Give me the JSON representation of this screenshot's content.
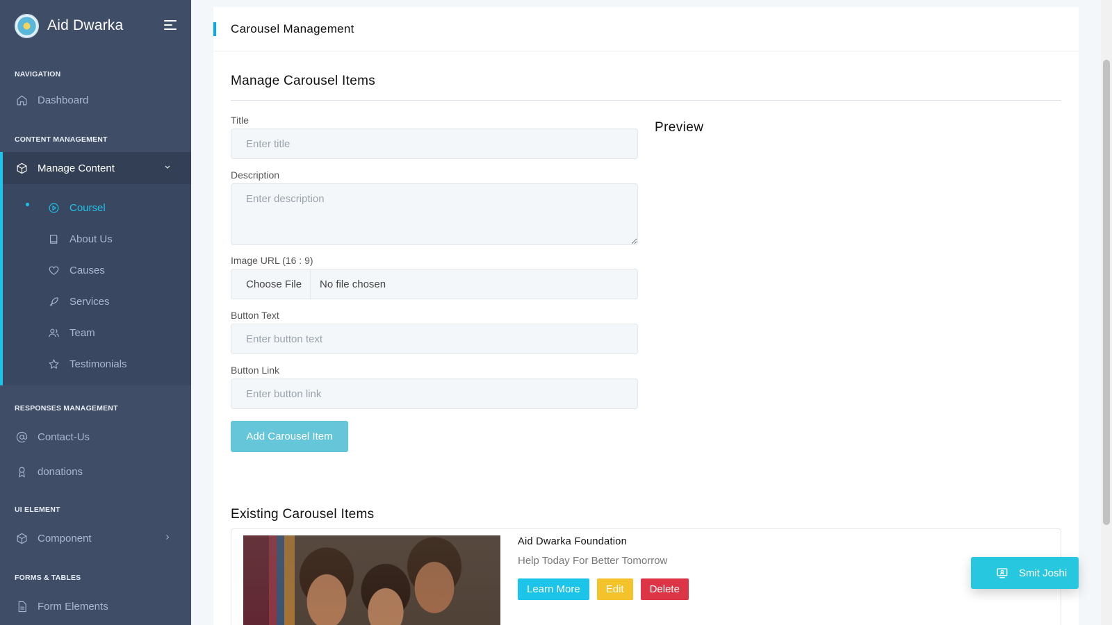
{
  "sidebar": {
    "brand": "Aid Dwarka",
    "sections": {
      "navigation": "NAVIGATION",
      "content_management": "CONTENT MANAGEMENT",
      "responses_management": "RESPONSES MANAGEMENT",
      "ui_element": "UI ELEMENT",
      "forms_tables": "FORMS & TABLES"
    },
    "dashboard": "Dashboard",
    "manage_content": "Manage Content",
    "sub_items": {
      "coursel": "Coursel",
      "about_us": "About Us",
      "causes": "Causes",
      "services": "Services",
      "team": "Team",
      "testimonials": "Testimonials"
    },
    "contact_us": "Contact-Us",
    "donations": "donations",
    "component": "Component",
    "form_elements": "Form Elements"
  },
  "page": {
    "header": "Carousel Management",
    "section_title": "Manage Carousel Items",
    "preview_title": "Preview",
    "existing_title": "Existing Carousel Items"
  },
  "form": {
    "title_label": "Title",
    "title_placeholder": "Enter title",
    "title_value": "",
    "description_label": "Description",
    "description_placeholder": "Enter description",
    "description_value": "",
    "image_label": "Image URL (16 : 9)",
    "choose_file": "Choose File",
    "no_file": "No file chosen",
    "button_text_label": "Button Text",
    "button_text_placeholder": "Enter button text",
    "button_text_value": "",
    "button_link_label": "Button Link",
    "button_link_placeholder": "Enter button link",
    "button_link_value": "",
    "submit": "Add Carousel Item"
  },
  "items": [
    {
      "title": "Aid Dwarka Foundation",
      "description": "Help Today For Better Tomorrow",
      "button": "Learn More",
      "edit": "Edit",
      "delete": "Delete"
    }
  ],
  "user": {
    "name": "Smit Joshi"
  },
  "colors": {
    "sidebar_bg": "#3f4d67",
    "accent": "#1dc4e9",
    "submit_btn": "#66c6d9",
    "edit_btn": "#f4c22b",
    "delete_btn": "#dc3545"
  }
}
